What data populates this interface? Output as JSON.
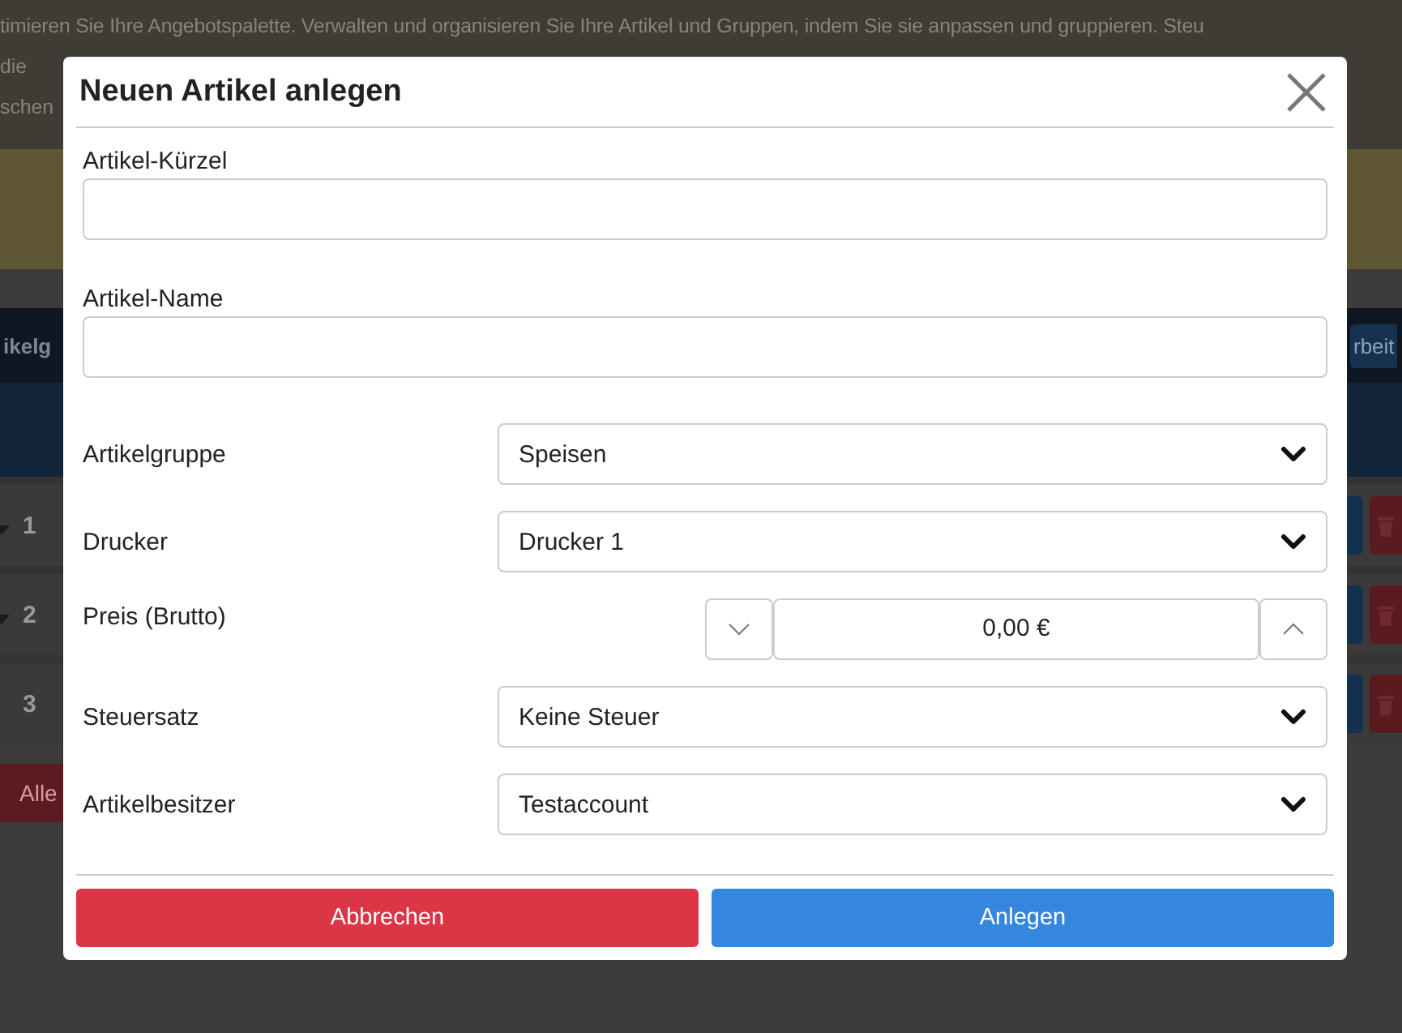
{
  "background": {
    "intro_lines": [
      "timieren Sie Ihre Angebotspalette. Verwalten und organisieren Sie Ihre Artikel und Gruppen, indem Sie sie anpassen und gruppieren. Steu",
      "die",
      "schen"
    ],
    "tab_label": "ikelg",
    "edit_button": "rbeit",
    "rows": [
      {
        "number": "1",
        "expandable": true
      },
      {
        "number": "2",
        "expandable": true
      },
      {
        "number": "3",
        "expandable": false
      }
    ],
    "delete_all_button": "Alle"
  },
  "dialog": {
    "title": "Neuen Artikel anlegen",
    "fields": [
      {
        "kind": "text",
        "label": "Artikel-Kürzel"
      },
      {
        "kind": "text",
        "label": "Artikel-Name"
      },
      {
        "kind": "select",
        "label": "Artikelgruppe",
        "value": "Speisen"
      },
      {
        "kind": "select",
        "label": "Drucker",
        "value": "Drucker 1"
      },
      {
        "kind": "stepper",
        "label": "Preis (Brutto)",
        "value": "0,00 €"
      },
      {
        "kind": "select",
        "label": "Steuersatz",
        "value": "Keine Steuer"
      },
      {
        "kind": "select",
        "label": "Artikelbesitzer",
        "value": "Testaccount"
      }
    ],
    "buttons": [
      {
        "kind": "cancel",
        "label": "Abbrechen"
      },
      {
        "kind": "confirm",
        "label": "Anlegen"
      }
    ]
  }
}
